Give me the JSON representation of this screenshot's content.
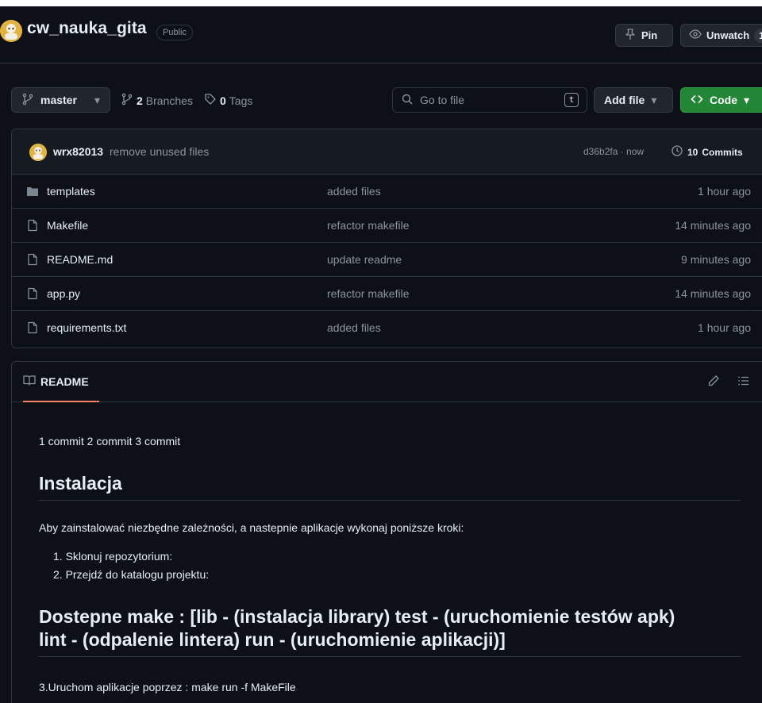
{
  "repo": {
    "name": "cw_nauka_gita",
    "visibility": "Public",
    "pin_label": "Pin",
    "watch_label": "Unwatch",
    "watch_count": "1"
  },
  "toolbar": {
    "branch": "master",
    "branches_count": "2",
    "branches_label": "Branches",
    "tags_count": "0",
    "tags_label": "Tags",
    "goto_placeholder": "Go to file",
    "goto_kbd": "t",
    "add_file_label": "Add file",
    "code_label": "Code"
  },
  "latest_commit": {
    "author": "wrx82013",
    "message": "remove unused files",
    "meta": "d36b2fa · now",
    "commits_count": "10",
    "commits_label": "Commits"
  },
  "files": [
    {
      "name": "templates",
      "type": "folder",
      "message": "added files",
      "time": "1 hour ago"
    },
    {
      "name": "Makefile",
      "type": "file",
      "message": "refactor makefile",
      "time": "14 minutes ago"
    },
    {
      "name": "README.md",
      "type": "file",
      "message": "update readme",
      "time": "9 minutes ago"
    },
    {
      "name": "app.py",
      "type": "file",
      "message": "refactor makefile",
      "time": "14 minutes ago"
    },
    {
      "name": "requirements.txt",
      "type": "file",
      "message": "added files",
      "time": "1 hour ago"
    }
  ],
  "readme": {
    "tab_label": "README",
    "p1": "1 commit 2 commit 3 commit",
    "h2_install": "Instalacja",
    "p_install": "Aby zainstalować niezbędne zależności, a nastepnie aplikacje wykonaj poniższe kroki:",
    "steps": [
      "1. Sklonuj repozytorium:",
      "2. Przejdź do katalogu projektu:"
    ],
    "h2_make_line1": "Dostepne make : [lib - (instalacja library) test - (uruchomienie testów apk)",
    "h2_make_line2": "lint - (odpalenie lintera) run - (uruchomienie aplikacji)]",
    "p_run": "3.Uruchom aplikacje poprzez : make run -f MakeFile"
  },
  "colors": {
    "background": "#0d1117",
    "border": "#30363d",
    "muted_text": "#8b949e",
    "code_button": "#238636",
    "tab_underline": "#f78166"
  }
}
